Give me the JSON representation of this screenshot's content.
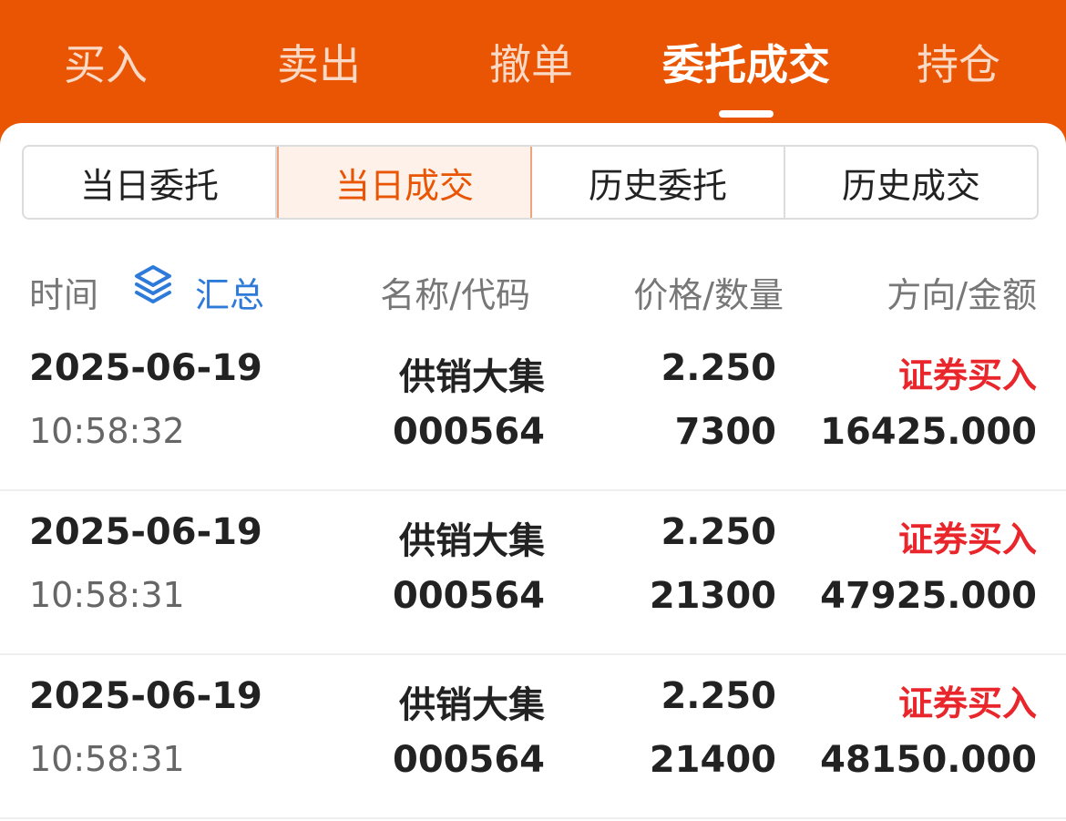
{
  "top_tabs": [
    {
      "label": "买入"
    },
    {
      "label": "卖出"
    },
    {
      "label": "撤单"
    },
    {
      "label": "委托成交"
    },
    {
      "label": "持仓"
    }
  ],
  "active_top_tab": "委托成交",
  "sub_tabs": [
    {
      "label": "当日委托"
    },
    {
      "label": "当日成交"
    },
    {
      "label": "历史委托"
    },
    {
      "label": "历史成交"
    }
  ],
  "active_sub_tab": "当日成交",
  "columns": {
    "time": "时间",
    "summary": "汇总",
    "name_code": "名称/代码",
    "price_qty": "价格/数量",
    "direction_amount": "方向/金额"
  },
  "rows": [
    {
      "date": "2025-06-19",
      "time": "10:58:32",
      "name": "供销大集",
      "code": "000564",
      "price": "2.250",
      "quantity": "7300",
      "direction": "证券买入",
      "amount": "16425.000"
    },
    {
      "date": "2025-06-19",
      "time": "10:58:31",
      "name": "供销大集",
      "code": "000564",
      "price": "2.250",
      "quantity": "21300",
      "direction": "证券买入",
      "amount": "47925.000"
    },
    {
      "date": "2025-06-19",
      "time": "10:58:31",
      "name": "供销大集",
      "code": "000564",
      "price": "2.250",
      "quantity": "21400",
      "direction": "证券买入",
      "amount": "48150.000"
    }
  ],
  "colors": {
    "brand": "#e95502",
    "buy": "#e8262b",
    "link": "#2e7ad8"
  },
  "icons": {
    "summary": "layers-icon"
  }
}
